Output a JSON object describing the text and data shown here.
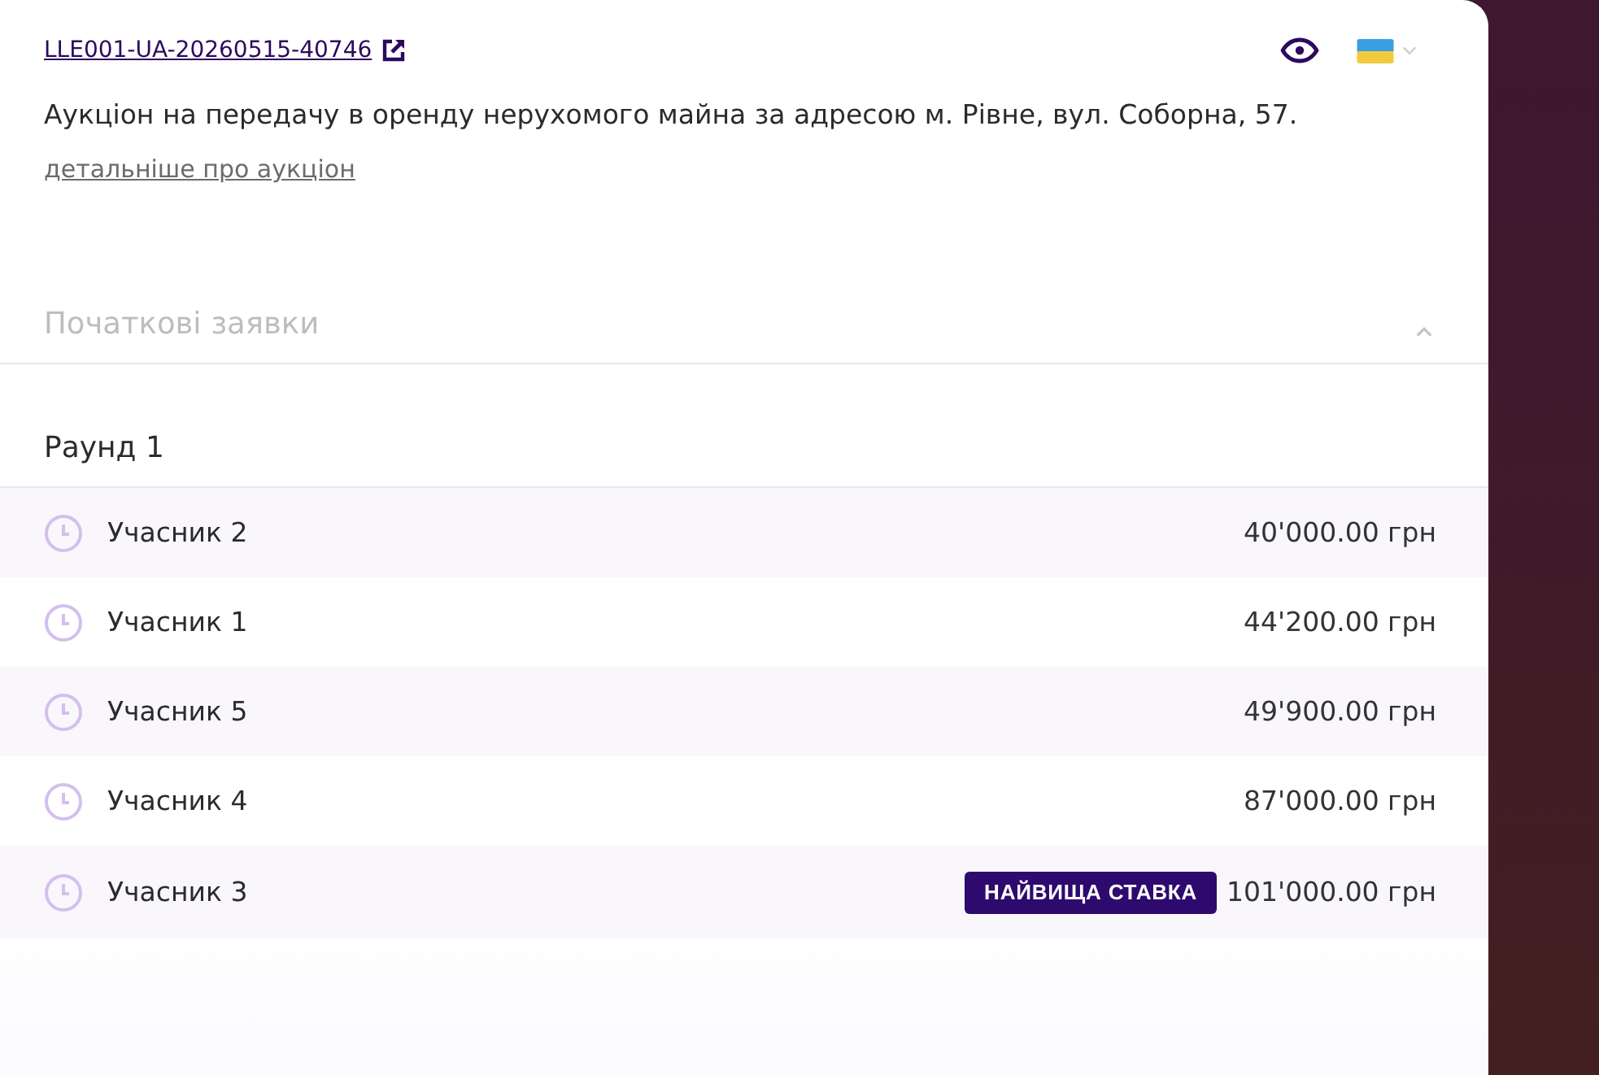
{
  "header": {
    "auction_id": "LLE001-UA-20260515-40746",
    "description": "Аукціон на передачу в оренду нерухомого майна за адресою м. Рівне, вул. Соборна, 57.",
    "details_link": "детальніше про аукціон"
  },
  "initial_bids": {
    "title": "Початкові заявки",
    "expanded": true
  },
  "round": {
    "title": "Раунд 1",
    "bids": [
      {
        "participant": "Учасник 2",
        "amount": "40'000.00 грн"
      },
      {
        "participant": "Учасник 1",
        "amount": "44'200.00 грн"
      },
      {
        "participant": "Учасник 5",
        "amount": "49'900.00 грн"
      },
      {
        "participant": "Учасник 4",
        "amount": "87'000.00 грн"
      },
      {
        "participant": "Учасник 3",
        "amount": "101'000.00 грн",
        "badge": "НАЙВИЩА СТАВКА"
      }
    ]
  }
}
